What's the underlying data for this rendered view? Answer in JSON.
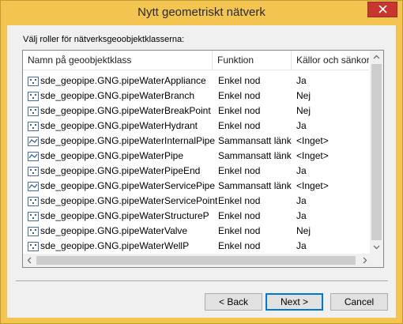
{
  "window": {
    "title": "Nytt geometriskt nätverk"
  },
  "prompt": "Välj roller för nätverksgeoobjektklasserna:",
  "columns": {
    "name": "Namn på geoobjektklass",
    "function": "Funktion",
    "sources": "Källor och sänkor"
  },
  "rows": [
    {
      "icon": "point-feature-icon",
      "name": "sde_geopipe.GNG.pipeWaterAppliance",
      "function": "Enkel nod",
      "sources": "Ja"
    },
    {
      "icon": "point-feature-icon",
      "name": "sde_geopipe.GNG.pipeWaterBranch",
      "function": "Enkel nod",
      "sources": "Nej"
    },
    {
      "icon": "point-feature-icon",
      "name": "sde_geopipe.GNG.pipeWaterBreakPoint",
      "function": "Enkel nod",
      "sources": "Nej"
    },
    {
      "icon": "point-feature-icon",
      "name": "sde_geopipe.GNG.pipeWaterHydrant",
      "function": "Enkel nod",
      "sources": "Ja"
    },
    {
      "icon": "line-feature-icon",
      "name": "sde_geopipe.GNG.pipeWaterInternalPipe",
      "function": "Sammansatt länk",
      "sources": "<Inget>"
    },
    {
      "icon": "line-feature-icon",
      "name": "sde_geopipe.GNG.pipeWaterPipe",
      "function": "Sammansatt länk",
      "sources": "<Inget>"
    },
    {
      "icon": "point-feature-icon",
      "name": "sde_geopipe.GNG.pipeWaterPipeEnd",
      "function": "Enkel nod",
      "sources": "Ja"
    },
    {
      "icon": "line-feature-icon",
      "name": "sde_geopipe.GNG.pipeWaterServicePipe",
      "function": "Sammansatt länk",
      "sources": "<Inget>"
    },
    {
      "icon": "point-feature-icon",
      "name": "sde_geopipe.GNG.pipeWaterServicePoint",
      "function": "Enkel nod",
      "sources": "Ja"
    },
    {
      "icon": "point-feature-icon",
      "name": "sde_geopipe.GNG.pipeWaterStructureP",
      "function": "Enkel nod",
      "sources": "Ja"
    },
    {
      "icon": "point-feature-icon",
      "name": "sde_geopipe.GNG.pipeWaterValve",
      "function": "Enkel nod",
      "sources": "Nej"
    },
    {
      "icon": "point-feature-icon",
      "name": "sde_geopipe.GNG.pipeWaterWellP",
      "function": "Enkel nod",
      "sources": "Ja"
    }
  ],
  "buttons": {
    "back": "< Back",
    "next": "Next >",
    "cancel": "Cancel"
  },
  "colors": {
    "titlebar": "#f3c44f",
    "close": "#c7372f",
    "accent": "#0078d7"
  }
}
